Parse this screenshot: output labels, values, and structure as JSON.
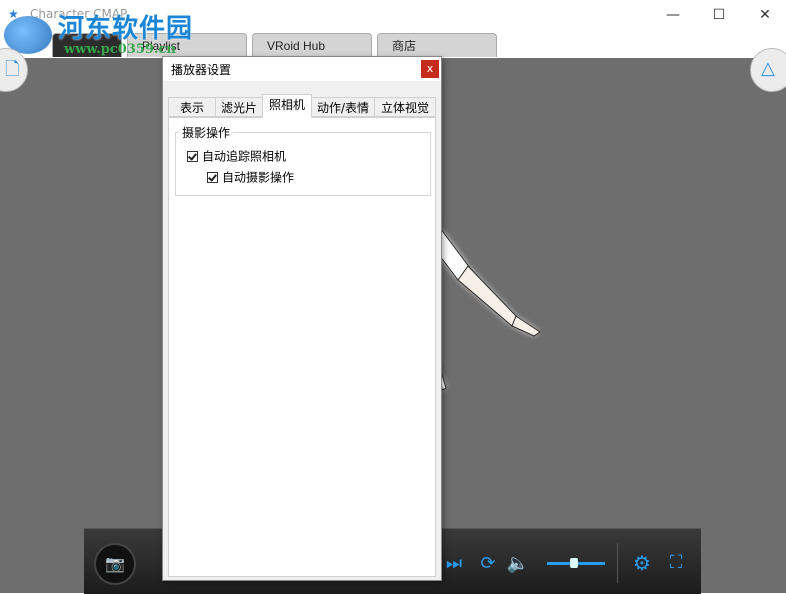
{
  "window": {
    "title": "Character CMAP",
    "minimize_glyph": "—",
    "maximize_glyph": "☐",
    "close_glyph": "✕"
  },
  "watermark": {
    "text": "河东软件园",
    "url": "www.pc0359.cn"
  },
  "main_tabs": [
    {
      "label": "",
      "active": true
    },
    {
      "label": "Playlist",
      "active": false
    },
    {
      "label": "VRoid Hub",
      "active": false
    },
    {
      "label": "商店",
      "active": false
    }
  ],
  "icons": {
    "tools": "tools-icon",
    "new_file": "new-file-icon",
    "vr_mode": "vr-triangle-icon",
    "camera": "camera-icon",
    "next": "skip-next-icon",
    "loop": "loop-icon",
    "volume": "speaker-icon",
    "settings": "gear-icon",
    "fullscreen": "fullscreen-icon"
  },
  "player": {
    "volume_level": 0.5
  },
  "settings_dialog": {
    "title": "播放器设置",
    "close_label": "x",
    "tabs": [
      {
        "label": "表示",
        "active": false
      },
      {
        "label": "滤光片",
        "active": false
      },
      {
        "label": "照相机",
        "active": true
      },
      {
        "label": "动作/表情",
        "active": false
      },
      {
        "label": "立体视觉",
        "active": false
      }
    ],
    "camera_panel": {
      "group_title": "摄影操作",
      "options": [
        {
          "label": "自动追踪照相机",
          "checked": true
        },
        {
          "label": "自动摄影操作",
          "checked": true
        }
      ]
    }
  },
  "colors": {
    "viewport_bg": "#6e6e6e",
    "accent_blue": "#2a9cf0",
    "dialog_close_red": "#c42b1c"
  }
}
